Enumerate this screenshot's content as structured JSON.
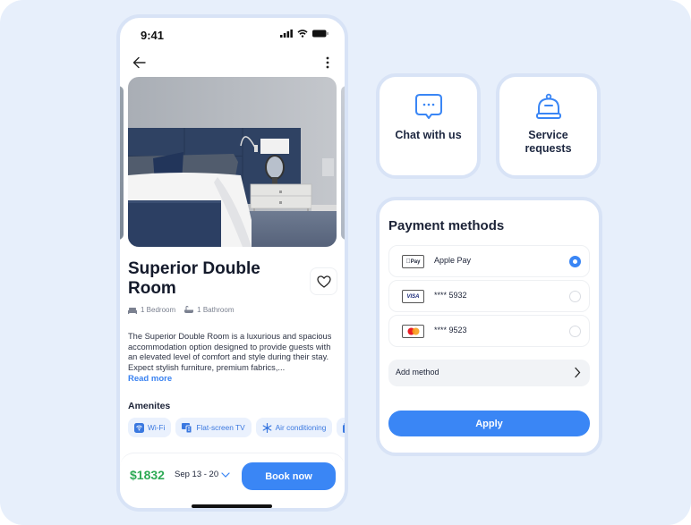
{
  "status_bar": {
    "time": "9:41"
  },
  "room": {
    "title": "Superior Double Room",
    "bedrooms": "1 Bedroom",
    "bathrooms": "1 Bathroom",
    "description": "The Superior Double Room is a luxurious and spacious accommodation option designed to provide guests with an elevated level of comfort and style during their stay. Expect stylish furniture, premium fabrics,...",
    "read_more": "Read more"
  },
  "amenities": {
    "title": "Amenites",
    "items": [
      {
        "label": "Wi-Fi",
        "icon": "wifi-icon"
      },
      {
        "label": "Flat-screen TV",
        "icon": "tv-icon"
      },
      {
        "label": "Air conditioning",
        "icon": "snowflake-icon"
      },
      {
        "label": "",
        "icon": "appliance-icon"
      }
    ]
  },
  "booking": {
    "price": "$1832",
    "dates": "Sep 13 - 20",
    "book_label": "Book now"
  },
  "quick_actions": [
    {
      "label": "Chat with us",
      "icon": "chat-bubble-icon"
    },
    {
      "label": "Service requests",
      "icon": "service-bell-icon"
    }
  ],
  "payment": {
    "title": "Payment methods",
    "options": [
      {
        "label": "Apple Pay",
        "logo": "Pay",
        "selected": true
      },
      {
        "label": "**** 5932",
        "logo": "VISA",
        "selected": false
      },
      {
        "label": "**** 9523",
        "logo": "mastercard",
        "selected": false
      }
    ],
    "add_method": "Add method",
    "apply": "Apply"
  },
  "colors": {
    "accent": "#3a86f5",
    "price_green": "#2eaa55",
    "background": "#e7effb"
  }
}
